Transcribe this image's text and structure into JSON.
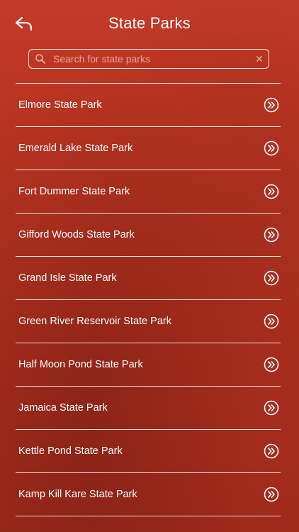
{
  "header": {
    "title": "State Parks",
    "back_icon": "back-arrow-icon"
  },
  "search": {
    "placeholder": "Search for state parks",
    "value": "",
    "search_icon": "search-icon",
    "clear_icon": "clear-icon",
    "clear_glyph": "✕"
  },
  "parks": [
    {
      "label": "Elmore State Park"
    },
    {
      "label": "Emerald Lake State Park"
    },
    {
      "label": "Fort Dummer State Park"
    },
    {
      "label": "Gifford Woods State Park"
    },
    {
      "label": "Grand Isle State Park"
    },
    {
      "label": "Green River Reservoir State Park"
    },
    {
      "label": "Half Moon Pond State Park"
    },
    {
      "label": "Jamaica State Park"
    },
    {
      "label": "Kettle Pond State Park"
    },
    {
      "label": "Kamp Kill Kare State Park"
    }
  ],
  "colors": {
    "background": "#b83320",
    "foreground": "#ffffff"
  }
}
